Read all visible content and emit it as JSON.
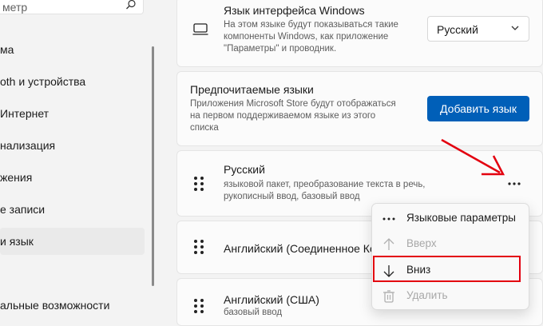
{
  "sidebar": {
    "search_text": "метр",
    "items": [
      {
        "label": "ма"
      },
      {
        "label": "oth и устройства"
      },
      {
        "label": "Интернет"
      },
      {
        "label": "нализация"
      },
      {
        "label": "жения"
      },
      {
        "label": "е записи"
      },
      {
        "label": "и язык"
      },
      {
        "label": "альные возможности"
      }
    ]
  },
  "main": {
    "windows_lang": {
      "title": "Язык интерфейса Windows",
      "desc": [
        "На этом языке будут показываться такие",
        "компоненты Windows, как приложение",
        "\"Параметры\" и проводник."
      ],
      "value": "Русский"
    },
    "preferred": {
      "title": "Предпочитаемые языки",
      "desc": [
        "Приложения Microsoft Store будут отображаться",
        "на первом поддерживаемом языке из этого",
        "списка"
      ],
      "button": "Добавить язык"
    },
    "languages": [
      {
        "name": "Русский",
        "desc": [
          "языковой пакет, преобразование текста в речь,",
          "рукописный ввод, базовый ввод"
        ]
      },
      {
        "name": "Английский (Соединенное Ко",
        "desc": []
      },
      {
        "name": "Английский (США)",
        "desc": [
          "базовый ввод"
        ]
      }
    ]
  },
  "context_menu": {
    "items": [
      {
        "label": "Языковые параметры",
        "icon": "more-icon",
        "enabled": true
      },
      {
        "label": "Вверх",
        "icon": "arrow-up-icon",
        "enabled": false
      },
      {
        "label": "Вниз",
        "icon": "arrow-down-icon",
        "enabled": true
      },
      {
        "label": "Удалить",
        "icon": "trash-icon",
        "enabled": false
      }
    ]
  },
  "colors": {
    "accent": "#005fb8",
    "annotation": "#e3000f"
  }
}
